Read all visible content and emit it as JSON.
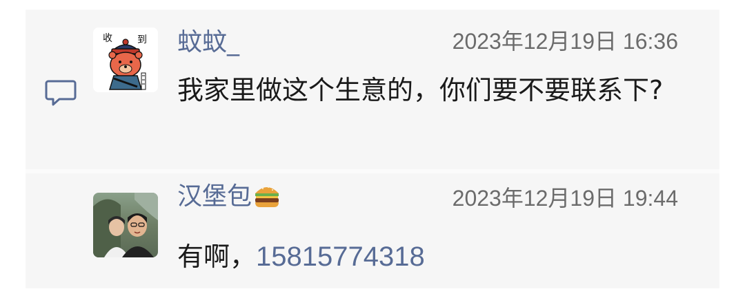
{
  "comments": [
    {
      "author": "蚊蚊_",
      "timestamp": "2023年12月19日 16:36",
      "text": "我家里做这个生意的，你们要不要联系下?",
      "avatar": {
        "text_top_left": "收",
        "text_top_right": "到",
        "description_icon": "bear-official-hat-sticker"
      }
    },
    {
      "author": "汉堡包",
      "author_emoji": "hamburger",
      "timestamp": "2023年12月19日 19:44",
      "text_prefix": "有啊，",
      "phone": "15815774318",
      "avatar": {
        "description_icon": "two-people-photo"
      }
    }
  ],
  "colors": {
    "name": "#576b95",
    "text": "#1a1a1a",
    "timestamp": "#6b6b6b",
    "panel": "#f6f6f6"
  },
  "icons": {
    "comment": "comment-bubble-icon"
  }
}
